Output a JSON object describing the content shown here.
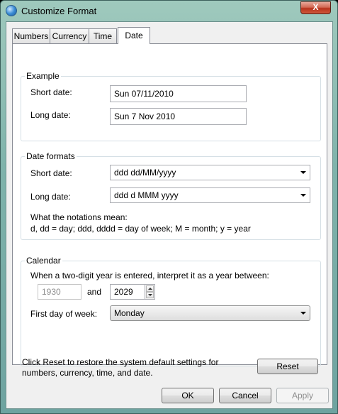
{
  "window": {
    "title": "Customize Format",
    "close_glyph": "X"
  },
  "tabs": [
    {
      "label": "Numbers"
    },
    {
      "label": "Currency"
    },
    {
      "label": "Time"
    },
    {
      "label": "Date"
    }
  ],
  "example": {
    "legend": "Example",
    "short_label": "Short date:",
    "short_value": "Sun 07/11/2010",
    "long_label": "Long date:",
    "long_value": "Sun 7 Nov 2010"
  },
  "date_formats": {
    "legend": "Date formats",
    "short_label": "Short date:",
    "short_value": "ddd dd/MM/yyyy",
    "long_label": "Long date:",
    "long_value": "ddd d MMM yyyy",
    "notation_title": "What the notations mean:",
    "notation_text": "d, dd = day;  ddd, dddd = day of week;  M = month;  y = year"
  },
  "calendar": {
    "legend": "Calendar",
    "two_digit_text": "When a two-digit year is entered, interpret it as a year between:",
    "from_year": "1930",
    "and_label": "and",
    "to_year": "2029",
    "first_day_label": "First day of week:",
    "first_day_value": "Monday"
  },
  "footer": {
    "reset_text": "Click Reset to restore the system default settings for numbers, currency, time, and date.",
    "reset_button": "Reset",
    "ok_button": "OK",
    "cancel_button": "Cancel",
    "apply_button": "Apply"
  }
}
